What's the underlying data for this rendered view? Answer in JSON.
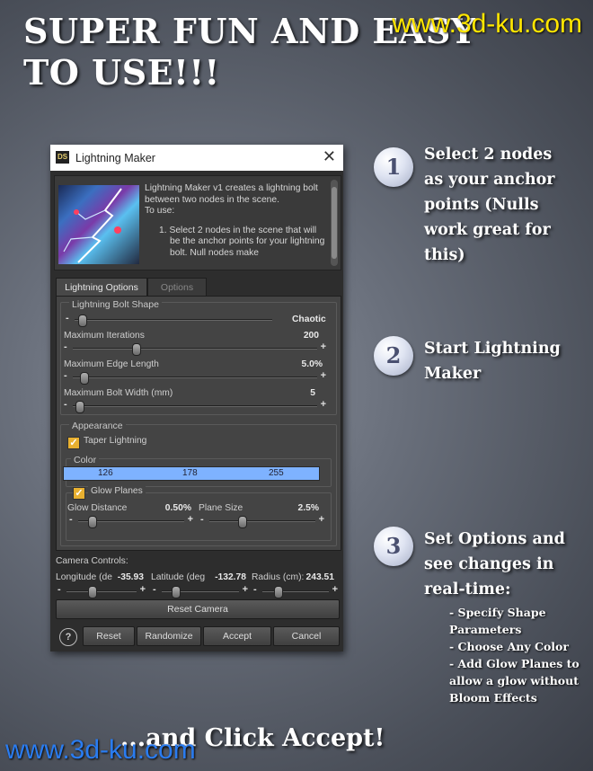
{
  "promo": {
    "headline": "SUPER FUN AND EASY\nTO USE!!!",
    "watermark_top": "www.3d-ku.com",
    "watermark_bottom": "www.3d-ku.com",
    "closing": "...and Click Accept!",
    "steps": [
      {
        "number": "1",
        "text": "Select 2 nodes\nas your anchor\npoints (Nulls\nwork great for\nthis)"
      },
      {
        "number": "2",
        "text": "Start Lightning\nMaker"
      },
      {
        "number": "3",
        "text": "Set Options and\nsee changes in\nreal-time:"
      }
    ],
    "bullets": [
      "- Specify Shape\nParameters",
      "- Choose Any Color",
      "- Add Glow Planes to\nallow a glow without\nBloom Effects"
    ]
  },
  "dialog": {
    "app_icon": "DS",
    "title": "Lightning Maker",
    "close_glyph": "✕",
    "info": {
      "intro": "Lightning Maker v1 creates a lightning bolt\nbetween two nodes in the scene.\nTo use:",
      "step": "1. Select 2 nodes in the scene that will be the anchor points for your lightning bolt. Null nodes make"
    },
    "tabs": [
      "Lightning Options",
      "Options"
    ],
    "bolt_shape": {
      "group_title": "Lightning Bolt Shape",
      "chaotic_label": "Chaotic",
      "chaotic_level": 0.02,
      "max_iterations": {
        "label": "Maximum Iterations",
        "value": "200",
        "level": 0.25
      },
      "max_edge_length": {
        "label": "Maximum Edge Length",
        "value": "5.0%",
        "level": 0.03
      },
      "max_bolt_width": {
        "label": "Maximum Bolt Width (mm)",
        "value": "5",
        "level": 0.01
      }
    },
    "appearance": {
      "group_title": "Appearance",
      "taper_label": "Taper Lightning",
      "color_title": "Color",
      "color_values": [
        "126",
        "178",
        "255"
      ],
      "color_hex": "#7eb2ff",
      "glow_label": "Glow Planes",
      "glow_distance": {
        "label": "Glow Distance",
        "value": "0.50%",
        "level": 0.1
      },
      "plane_size": {
        "label": "Plane Size",
        "value": "2.5%",
        "level": 0.3
      }
    },
    "camera": {
      "group_title": "Camera Controls:",
      "longitude": {
        "label": "Longitude (de",
        "value": "-35.93",
        "level": 0.35
      },
      "latitude": {
        "label": "Latitude (deg",
        "value": "-132.78",
        "level": 0.15
      },
      "radius": {
        "label": "Radius (cm):",
        "value": "243.51",
        "level": 0.2
      },
      "reset_label": "Reset Camera"
    },
    "buttons": {
      "help": "?",
      "reset": "Reset",
      "randomize": "Randomize",
      "accept": "Accept",
      "cancel": "Cancel"
    }
  }
}
